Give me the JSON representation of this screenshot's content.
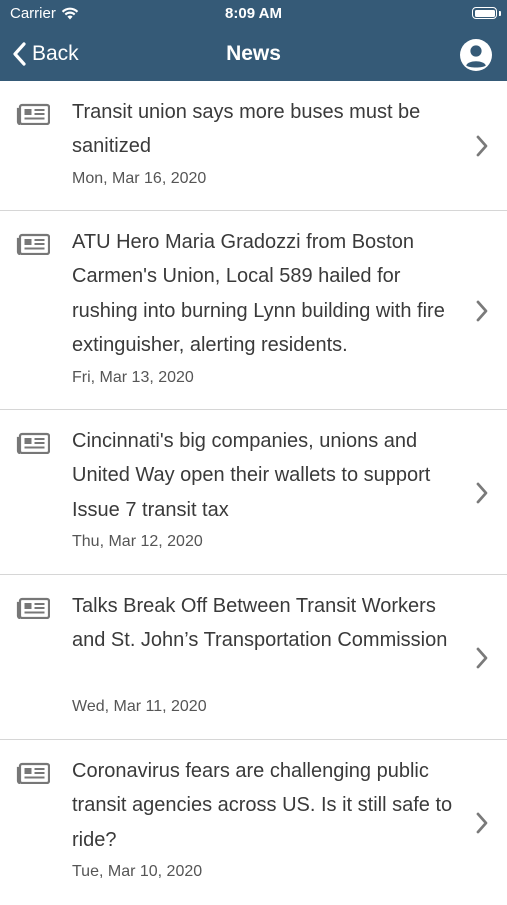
{
  "status_bar": {
    "carrier": "Carrier",
    "time": "8:09 AM"
  },
  "nav": {
    "back_label": "Back",
    "title": "News"
  },
  "articles": [
    {
      "title": "Transit union says more buses must be sanitized",
      "date": "Mon, Mar 16, 2020"
    },
    {
      "title": "ATU Hero Maria Gradozzi from Boston Carmen's Union, Local 589 hailed for rushing into burning Lynn building with fire extinguisher, alerting residents.",
      "date": "Fri, Mar 13, 2020"
    },
    {
      "title": "Cincinnati's big companies, unions and United Way open their wallets to support Issue 7 transit tax",
      "date": "Thu, Mar 12, 2020"
    },
    {
      "title": "Talks Break Off Between Transit Workers and St. John’s Transportation Commission",
      "date": "Wed, Mar 11, 2020"
    },
    {
      "title": "Coronavirus fears are challenging public transit agencies across US. Is it still safe to ride?",
      "date": "Tue, Mar 10, 2020"
    }
  ],
  "colors": {
    "header": "#355a77",
    "icon": "#777777",
    "chevron": "#7a7a7a"
  },
  "icons": {
    "article": "newspaper-icon",
    "row_action": "chevron-right-icon",
    "back": "chevron-left-icon",
    "profile": "user-circle-icon",
    "wifi": "wifi-icon",
    "battery": "battery-icon"
  }
}
